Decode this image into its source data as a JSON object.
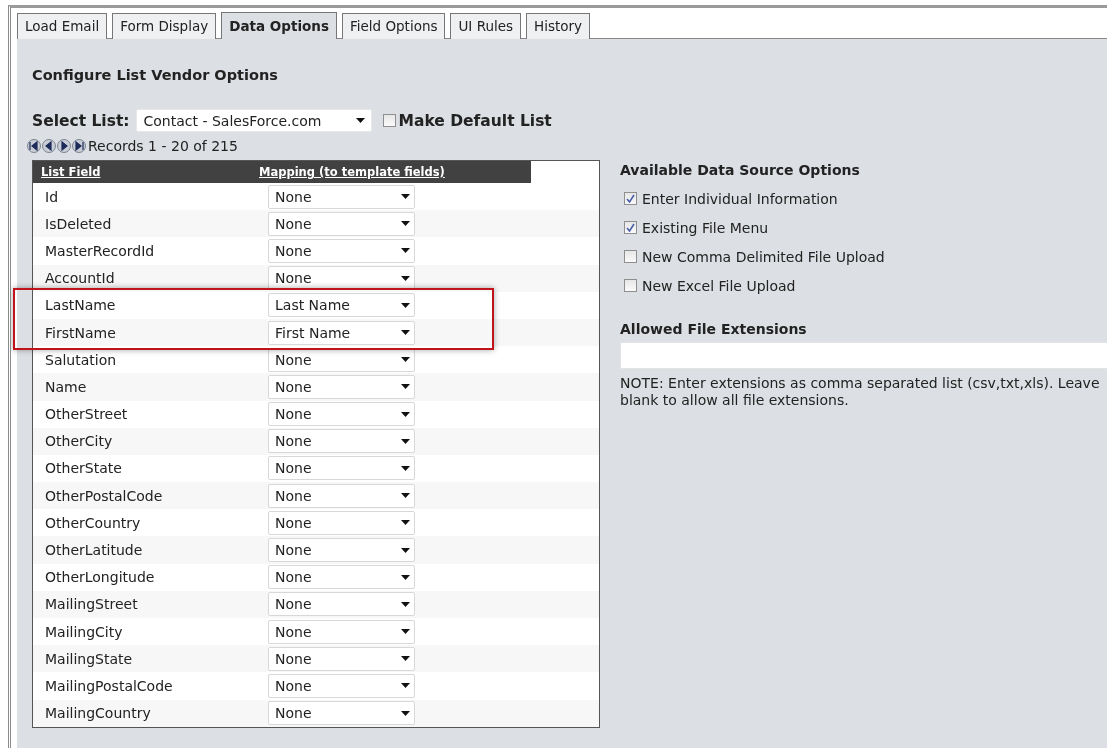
{
  "tabs": [
    {
      "label": "Load Email",
      "selected": false
    },
    {
      "label": "Form Display",
      "selected": false
    },
    {
      "label": "Data Options",
      "selected": true
    },
    {
      "label": "Field Options",
      "selected": false
    },
    {
      "label": "UI Rules",
      "selected": false
    },
    {
      "label": "History",
      "selected": false
    }
  ],
  "heading": "Configure List Vendor Options",
  "select_list": {
    "label": "Select List:",
    "value": "Contact - SalesForce.com"
  },
  "make_default": {
    "label": "Make Default List",
    "checked": false
  },
  "pager": {
    "text": "Records 1 - 20 of 215"
  },
  "table": {
    "columns": [
      "List Field",
      "Mapping (to template fields)"
    ],
    "rows": [
      {
        "field": "Id",
        "mapping": "None",
        "highlighted": false
      },
      {
        "field": "IsDeleted",
        "mapping": "None",
        "highlighted": false
      },
      {
        "field": "MasterRecordId",
        "mapping": "None",
        "highlighted": false
      },
      {
        "field": "AccountId",
        "mapping": "None",
        "highlighted": false
      },
      {
        "field": "LastName",
        "mapping": "Last Name",
        "highlighted": true
      },
      {
        "field": "FirstName",
        "mapping": "First Name",
        "highlighted": true
      },
      {
        "field": "Salutation",
        "mapping": "None",
        "highlighted": false
      },
      {
        "field": "Name",
        "mapping": "None",
        "highlighted": false
      },
      {
        "field": "OtherStreet",
        "mapping": "None",
        "highlighted": false
      },
      {
        "field": "OtherCity",
        "mapping": "None",
        "highlighted": false
      },
      {
        "field": "OtherState",
        "mapping": "None",
        "highlighted": false
      },
      {
        "field": "OtherPostalCode",
        "mapping": "None",
        "highlighted": false
      },
      {
        "field": "OtherCountry",
        "mapping": "None",
        "highlighted": false
      },
      {
        "field": "OtherLatitude",
        "mapping": "None",
        "highlighted": false
      },
      {
        "field": "OtherLongitude",
        "mapping": "None",
        "highlighted": false
      },
      {
        "field": "MailingStreet",
        "mapping": "None",
        "highlighted": false
      },
      {
        "field": "MailingCity",
        "mapping": "None",
        "highlighted": false
      },
      {
        "field": "MailingState",
        "mapping": "None",
        "highlighted": false
      },
      {
        "field": "MailingPostalCode",
        "mapping": "None",
        "highlighted": false
      },
      {
        "field": "MailingCountry",
        "mapping": "None",
        "highlighted": false
      }
    ]
  },
  "data_source": {
    "title": "Available Data Source Options",
    "options": [
      {
        "label": "Enter Individual Information",
        "checked": true
      },
      {
        "label": "Existing File Menu",
        "checked": true
      },
      {
        "label": "New Comma Delimited File Upload",
        "checked": false
      },
      {
        "label": "New Excel File Upload",
        "checked": false
      }
    ]
  },
  "extensions": {
    "title": "Allowed File Extensions",
    "note": "NOTE: Enter extensions as comma separated list (csv,txt,xls). Leave blank to allow all file extensions."
  }
}
